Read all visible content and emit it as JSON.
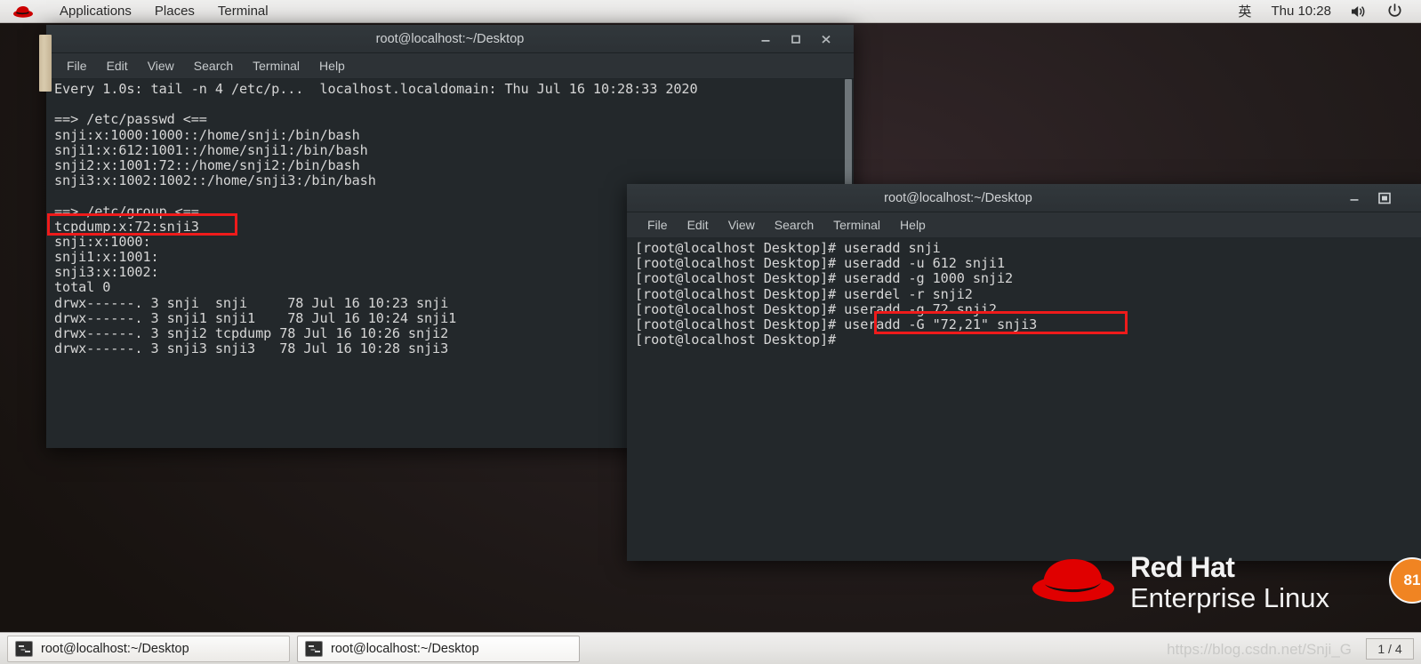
{
  "top_panel": {
    "logo_icon": "redhat-logo-icon",
    "menus": [
      "Applications",
      "Places",
      "Terminal"
    ],
    "ime_indicator": "英",
    "clock": "Thu 10:28",
    "volume_icon": "volume-icon",
    "power_icon": "power-icon"
  },
  "terminal1": {
    "title": "root@localhost:~/Desktop",
    "menus": [
      "File",
      "Edit",
      "View",
      "Search",
      "Terminal",
      "Help"
    ],
    "window_buttons": [
      "minimize",
      "maximize",
      "close"
    ],
    "lines": [
      "Every 1.0s: tail -n 4 /etc/p...  localhost.localdomain: Thu Jul 16 10:28:33 2020",
      "",
      "==> /etc/passwd <==",
      "snji:x:1000:1000::/home/snji:/bin/bash",
      "snji1:x:612:1001::/home/snji1:/bin/bash",
      "snji2:x:1001:72::/home/snji2:/bin/bash",
      "snji3:x:1002:1002::/home/snji3:/bin/bash",
      "",
      "==> /etc/group <==",
      "tcpdump:x:72:snji3",
      "snji:x:1000:",
      "snji1:x:1001:",
      "snji3:x:1002:",
      "total 0",
      "drwx------. 3 snji  snji     78 Jul 16 10:23 snji",
      "drwx------. 3 snji1 snji1    78 Jul 16 10:24 snji1",
      "drwx------. 3 snji2 tcpdump 78 Jul 16 10:26 snji2",
      "drwx------. 3 snji3 snji3   78 Jul 16 10:28 snji3"
    ],
    "highlight": "tcpdump:x:72:snji3"
  },
  "terminal2": {
    "title": "root@localhost:~/Desktop",
    "menus": [
      "File",
      "Edit",
      "View",
      "Search",
      "Terminal",
      "Help"
    ],
    "window_buttons": [
      "minimize",
      "maximize"
    ],
    "lines": [
      "[root@localhost Desktop]# useradd snji",
      "[root@localhost Desktop]# useradd -u 612 snji1",
      "[root@localhost Desktop]# useradd -g 1000 snji2",
      "[root@localhost Desktop]# userdel -r snji2",
      "[root@localhost Desktop]# useradd -g 72 snji2",
      "[root@localhost Desktop]# useradd -G \"72,21\" snji3",
      "[root@localhost Desktop]# "
    ],
    "highlight": "useradd -G \"72,21\" snji3"
  },
  "branding": {
    "line1": "Red Hat",
    "line2": "Enterprise Linux",
    "hat_icon": "redhat-hat-icon",
    "accent_color": "#e00000"
  },
  "badge": {
    "label": "81",
    "color": "#f08422"
  },
  "taskbar": {
    "tasks": [
      {
        "label": "root@localhost:~/Desktop",
        "icon": "terminal-icon",
        "active": false
      },
      {
        "label": "root@localhost:~/Desktop",
        "icon": "terminal-icon",
        "active": true
      }
    ],
    "workspace": "1 / 4",
    "watermark": "https://blog.csdn.net/Snji_G"
  },
  "colors": {
    "terminal_bg": "#23282b",
    "terminal_titlebar": "#2f3438",
    "highlight_red": "#ef1b1b",
    "panel_bg": "#e8e7e6"
  }
}
